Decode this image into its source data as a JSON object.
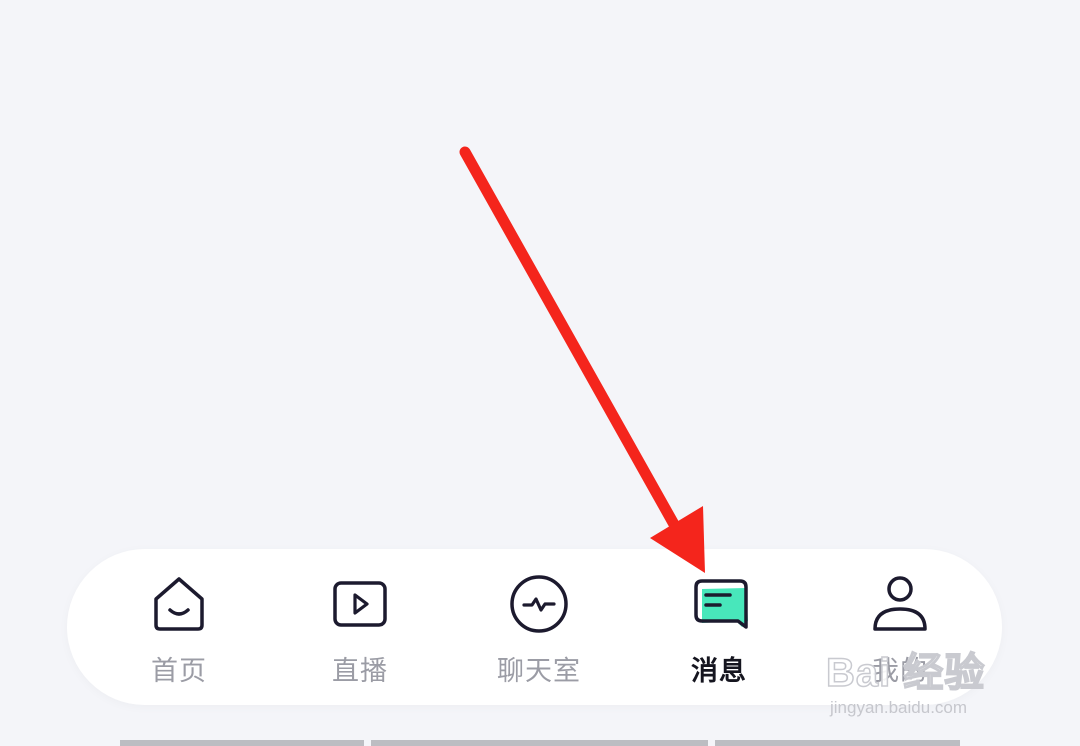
{
  "tabbar": {
    "tabs": [
      {
        "label": "首页",
        "icon": "home-icon"
      },
      {
        "label": "直播",
        "icon": "play-icon"
      },
      {
        "label": "聊天室",
        "icon": "pulse-icon"
      },
      {
        "label": "消息",
        "icon": "message-icon",
        "active": true
      },
      {
        "label": "我的",
        "icon": "user-icon"
      }
    ]
  },
  "colors": {
    "background": "#f4f5f9",
    "tabbar_bg": "#ffffff",
    "icon_stroke": "#1c1a2e",
    "active_accent": "#3ee6b7",
    "inactive_label": "#9b9ca5",
    "active_label": "#15151f",
    "arrow": "#f4251c"
  },
  "watermark": {
    "text": "Bai 经验",
    "url": "jingyan.baidu.com"
  }
}
